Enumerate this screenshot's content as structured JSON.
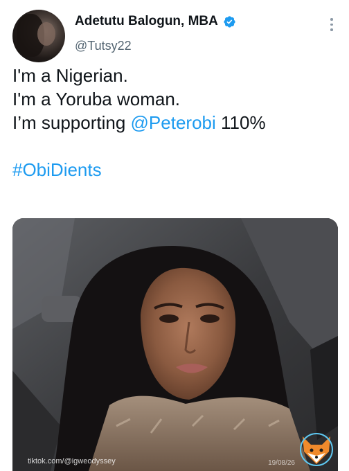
{
  "author": {
    "display_name": "Adetutu Balogun, MBA",
    "handle": "@Tutsy22",
    "verified": true
  },
  "tweet": {
    "line1": "I'm a Nigerian.",
    "line2": "I'm a Yoruba woman.",
    "line3_prefix": "I’m supporting ",
    "mention": "@Peterobi",
    "line3_suffix": " 110%",
    "hashtag": "#ObiDients"
  },
  "overlay": {
    "watermark": "tiktok.com/@igweodyssey",
    "date": "19/08/26"
  },
  "colors": {
    "link_blue": "#1d9bf0",
    "verified_blue": "#1d9bf0",
    "text": "#0f1419",
    "secondary": "#536471"
  },
  "icons": {
    "verified": "verified-badge-icon",
    "more": "more-options-icon",
    "logo": "fox-logo-icon"
  }
}
